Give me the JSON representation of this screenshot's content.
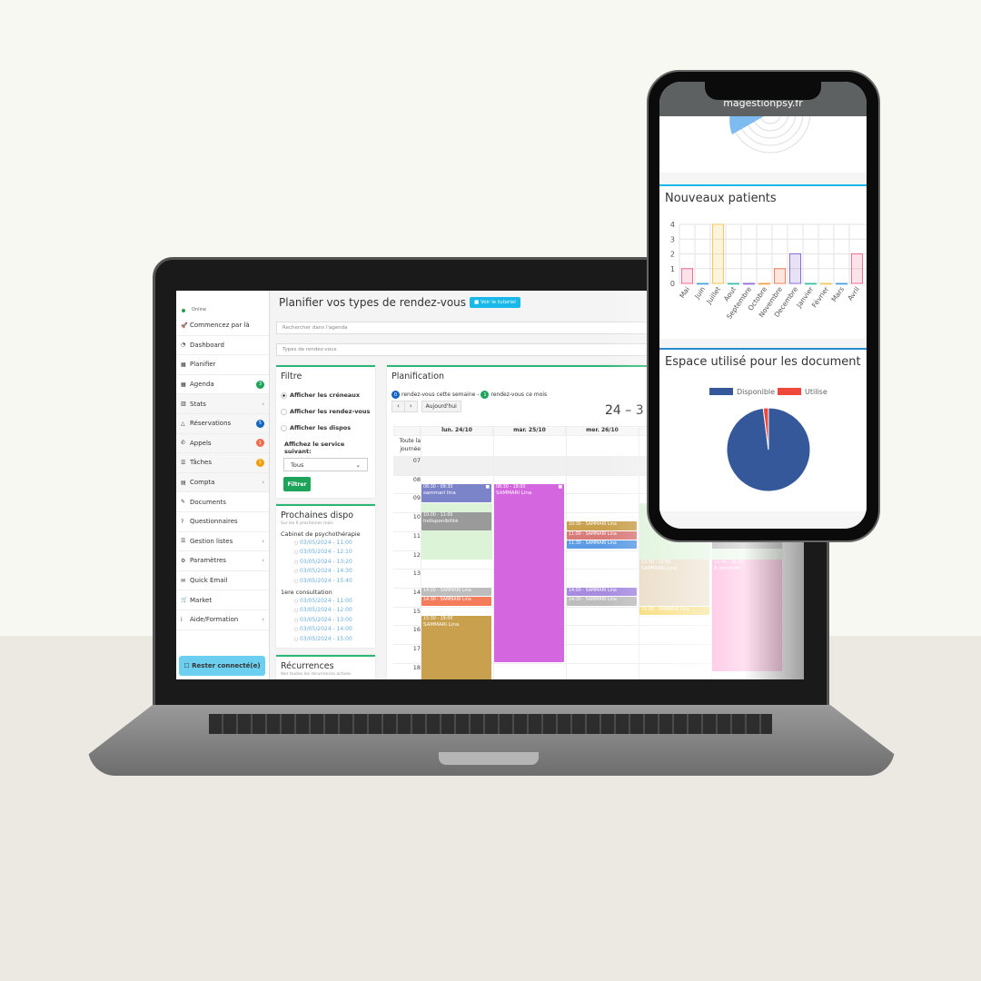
{
  "laptop": {
    "sidebar": {
      "status": "Online",
      "items": [
        {
          "icon": "rocket-icon",
          "glyph": "🚀",
          "label": "Commencez par là"
        },
        {
          "icon": "dashboard-icon",
          "glyph": "◔",
          "label": "Dashboard"
        },
        {
          "icon": "calendar-icon",
          "glyph": "▦",
          "label": "Planifier"
        },
        {
          "icon": "calendar-icon",
          "glyph": "▦",
          "label": "Agenda",
          "badge": "3",
          "badge_color": "#1ea35a"
        },
        {
          "icon": "chart-icon",
          "glyph": "▥",
          "label": "Stats",
          "chevron": true
        },
        {
          "icon": "bell-icon",
          "glyph": "△",
          "label": "Réservations",
          "badge": "5",
          "badge_color": "#1565c0"
        },
        {
          "icon": "phone-icon",
          "glyph": "✆",
          "label": "Appels",
          "badge": "1",
          "badge_color": "#f26b4a"
        },
        {
          "icon": "list-icon",
          "glyph": "☰",
          "label": "Tâches",
          "badge": "1",
          "badge_color": "#f59e0b"
        },
        {
          "icon": "calculator-icon",
          "glyph": "▤",
          "label": "Compta",
          "chevron": true
        },
        {
          "icon": "paperclip-icon",
          "glyph": "✎",
          "label": "Documents"
        },
        {
          "icon": "question-icon",
          "glyph": "?",
          "label": "Questionnaires"
        },
        {
          "icon": "list-icon",
          "glyph": "☰",
          "label": "Gestion listes",
          "chevron": true
        },
        {
          "icon": "gear-icon",
          "glyph": "⚙",
          "label": "Paramètres",
          "chevron": true
        },
        {
          "icon": "envelope-icon",
          "glyph": "✉",
          "label": "Quick Email"
        },
        {
          "icon": "cart-icon",
          "glyph": "🛒",
          "label": "Market"
        },
        {
          "icon": "info-icon",
          "glyph": "i",
          "label": "Aide/Formation",
          "chevron": true
        }
      ],
      "stay_connected": "Rester connecté(e)"
    },
    "header": {
      "title": "Planifier vos types de rendez-vous",
      "tutorial": "Voir le tutoriel"
    },
    "search": {
      "placeholder": "Rechercher dans l'agenda"
    },
    "types": {
      "placeholder": "Types de rendez-vous"
    },
    "filter": {
      "title": "Filtre",
      "options": [
        "Afficher les créneaux",
        "Afficher les rendez-vous",
        "Afficher les dispos"
      ],
      "selected": 0,
      "service_label": "Affichez le service suivant:",
      "service_value": "Tous",
      "button": "Filtrer"
    },
    "next": {
      "title": "Prochaines dispo",
      "subtitle": "Sur les 6 prochaines mois",
      "groups": [
        {
          "name": "Cabinet de psychothérapie",
          "slots": [
            "03/05/2024 - 11:00",
            "03/05/2024 - 12:10",
            "03/05/2024 - 13:20",
            "03/05/2024 - 14:30",
            "03/05/2024 - 15:40"
          ]
        },
        {
          "name": "1ere consultation",
          "slots": [
            "03/05/2024 - 11:00",
            "03/05/2024 - 12:00",
            "03/05/2024 - 13:00",
            "03/05/2024 - 14:00",
            "03/05/2024 - 15:00"
          ]
        }
      ]
    },
    "recurrences": {
      "title": "Récurrences",
      "subtitle": "Voir toutes les récurrences actives"
    },
    "planning": {
      "title": "Planification",
      "week_count": "0",
      "week_text": "rendez-vous cette semaine -",
      "month_count": "1",
      "month_text": "rendez-vous ce mois",
      "today": "Aujourd'hui",
      "range": "24 – 3",
      "allday": "Toute la journée",
      "days": [
        "lun. 24/10",
        "mar. 25/10",
        "mer. 26/10",
        "",
        ""
      ],
      "hours": [
        "07",
        "08",
        "09",
        "10",
        "11",
        "12",
        "13",
        "14",
        "15",
        "16",
        "17",
        "18"
      ],
      "availability": [
        {
          "day": 0,
          "start": "09:30",
          "end": "12:30"
        },
        {
          "day": 3,
          "start": "09:30",
          "end": "12:30"
        },
        {
          "day": 4,
          "start": "11:30",
          "end": "12:30"
        }
      ],
      "events": [
        {
          "day": 0,
          "start": "08:30",
          "end": "09:30",
          "time": "08:30 - 09:30",
          "title": "sammari lina",
          "color": "#7b83c9",
          "video": true
        },
        {
          "day": 0,
          "start": "10:00",
          "end": "11:00",
          "time": "10:00 - 11:00",
          "title": "Indisponibilité",
          "color": "#9a9a9a"
        },
        {
          "day": 0,
          "start": "14:00",
          "end": "14:30",
          "time": "14:00 - SAMMARI Lina",
          "title": "",
          "color": "#bdbdbd"
        },
        {
          "day": 0,
          "start": "14:30",
          "end": "15:00",
          "time": "14:30 - SAMMARI Lina",
          "title": "",
          "color": "#f47c5a"
        },
        {
          "day": 0,
          "start": "15:30",
          "end": "19:00",
          "time": "15:30 - 19:00",
          "title": "SAMMARI Lina",
          "color": "#c9a04d"
        },
        {
          "day": 1,
          "start": "08:30",
          "end": "18:00",
          "time": "08:30 - 18:00",
          "title": "SAMMARI Lina",
          "color": "#d466e0",
          "video": true
        },
        {
          "day": 2,
          "start": "10:30",
          "end": "11:00",
          "time": "10:30 - SAMMARI Lina",
          "title": "",
          "color": "#c9a04d"
        },
        {
          "day": 2,
          "start": "11:00",
          "end": "11:30",
          "time": "11:00 - SAMMARI Lina",
          "title": "",
          "color": "#d97a7a"
        },
        {
          "day": 2,
          "start": "11:30",
          "end": "12:00",
          "time": "11:30 - SAMMARI Lina",
          "title": "",
          "color": "#5b9be6"
        },
        {
          "day": 2,
          "start": "14:00",
          "end": "14:30",
          "time": "14:00 - SAMMARI Lina",
          "title": "",
          "color": "#a68be0"
        },
        {
          "day": 2,
          "start": "14:30",
          "end": "15:00",
          "time": "14:30 - SAMMARI Lina",
          "title": "",
          "color": "#bdbdbd"
        },
        {
          "day": 3,
          "start": "12:30",
          "end": "15:00",
          "time": "12:30 - 15:00",
          "title": "SAMMARI Lina",
          "color": "#e8d9c0"
        },
        {
          "day": 3,
          "start": "15:00",
          "end": "15:30",
          "time": "15:00 - SAMMARI Lina",
          "title": "",
          "color": "#f7d96a"
        },
        {
          "day": 4,
          "start": "11:30",
          "end": "12:00",
          "time": "",
          "title": "",
          "color": "#8a8a8a"
        },
        {
          "day": 4,
          "start": "12:30",
          "end": "18:30",
          "time": "12:30 - 18:30",
          "title": "À domicile",
          "color": "#ff8ac8"
        }
      ]
    }
  },
  "phone": {
    "url": "magestionpsy.fr",
    "new_patients": {
      "title": "Nouveaux patients"
    },
    "storage": {
      "title": "Espace utilisé pour les document"
    },
    "chart_data": [
      {
        "type": "bar",
        "title": "Nouveaux patients",
        "categories": [
          "Mai",
          "Juin",
          "Juillet",
          "Aout",
          "Septembre",
          "Octobre",
          "Novembre",
          "Decembre",
          "Janvier",
          "Février",
          "Mars",
          "Avril"
        ],
        "values": [
          1,
          0,
          4,
          0,
          0,
          0,
          1,
          2,
          0,
          0,
          0,
          2
        ],
        "colors": [
          "#f06f8f",
          "#4aa3df",
          "#f5c75c",
          "#3fbfa8",
          "#8e6cd6",
          "#f5a34a",
          "#f0805a",
          "#8e6cd6",
          "#3fbfa8",
          "#f5c75c",
          "#4aa3df",
          "#f06f8f"
        ],
        "yticks": [
          "0",
          "1",
          "2",
          "3",
          "4"
        ],
        "ylim": [
          0,
          4
        ],
        "grid": true
      },
      {
        "type": "pie",
        "title": "Espace utilisé pour les document",
        "legend": "top",
        "slices": [
          {
            "name": "Disponible",
            "value": 98,
            "color": "#34589a"
          },
          {
            "name": "Utilise",
            "value": 2,
            "color": "#f0473c"
          }
        ]
      }
    ]
  }
}
